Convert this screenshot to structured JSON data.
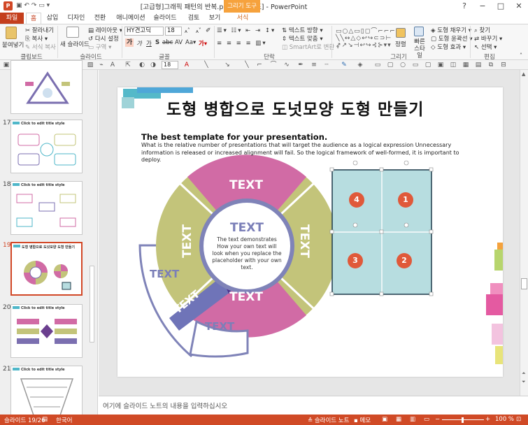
{
  "window": {
    "title": "[고급형]그래픽 패턴의 반복.ppt [호환 모드] - PowerPoint",
    "context_tab": "그리기 도구",
    "controls": [
      "?",
      "−",
      "□",
      "✕"
    ]
  },
  "tabs": [
    "파일",
    "홈",
    "삽입",
    "디자인",
    "전환",
    "애니메이션",
    "슬라이드 쇼",
    "검토",
    "보기",
    "서식"
  ],
  "ribbon": {
    "clipboard": {
      "paste": "붙여넣기",
      "cut": "잘라내기",
      "copy": "복사",
      "format_painter": "서식 복사",
      "label": "클립보드"
    },
    "slides": {
      "new_slide": "새 슬라이드",
      "layout": "레이아웃",
      "reset": "다시 설정",
      "section": "구역",
      "label": "슬라이드"
    },
    "font": {
      "name": "HY견고딕",
      "size": "18",
      "label": "글꼴"
    },
    "paragraph": {
      "text_direction": "텍스트 방향",
      "align_text": "텍스트 맞춤",
      "smartart": "SmartArt로 변환",
      "label": "단락"
    },
    "drawing": {
      "arrange": "정렬",
      "quick_styles": "빠른 스타일",
      "fill": "도형 채우기",
      "outline": "도형 윤곽선",
      "effects": "도형 효과",
      "label": "그리기"
    },
    "editing": {
      "find": "찾기",
      "replace": "바꾸기",
      "select": "선택",
      "label": "편집"
    }
  },
  "toolbar2": {
    "font_size": "18"
  },
  "thumbnails": [
    {
      "num": "17",
      "title": "Click to edit title style"
    },
    {
      "num": "18",
      "title": "Click to edit title style"
    },
    {
      "num": "19",
      "title": "도형 병합으로 도넛모양 도형 만들기"
    },
    {
      "num": "20",
      "title": "Click to edit title style"
    },
    {
      "num": "21",
      "title": "Click to edit title style"
    }
  ],
  "slide": {
    "title": "도형 병합으로 도넛모양 도형 만들기",
    "subtitle": "The best template for your presentation.",
    "body": "What is the relative number of presentations that will target the audience as a logical expression Unnecessary information is released or increased alignment will fail. So the logical framework of well-formed, it is important to deploy.",
    "donut": {
      "segment_top": "TEXT",
      "segment_left": "TEXT",
      "segment_right": "TEXT",
      "segment_bottom": "TEXT",
      "center_title": "TEXT",
      "center_body": "The text demonstrates How your own text will look when you replace the placeholder with your own text.",
      "slice_left": "TEXT",
      "slice_bottom": "TEXT",
      "slice_arrow": "TEXT"
    },
    "grid_numbers": [
      "4",
      "1",
      "3",
      "2"
    ]
  },
  "notes": {
    "placeholder": "여기에 슬라이드 노트의 내용을 입력하십시오"
  },
  "status": {
    "slide_counter": "슬라이드 19/26",
    "language": "한국어",
    "notes": "슬라이드 노트",
    "comments": "메모",
    "zoom": "100 %"
  },
  "colors": {
    "accent": "#d24726",
    "pink": "#d16ba5",
    "olive": "#c3c47a",
    "purple": "#7b6fb0",
    "teal_grid": "#b7dde0"
  }
}
